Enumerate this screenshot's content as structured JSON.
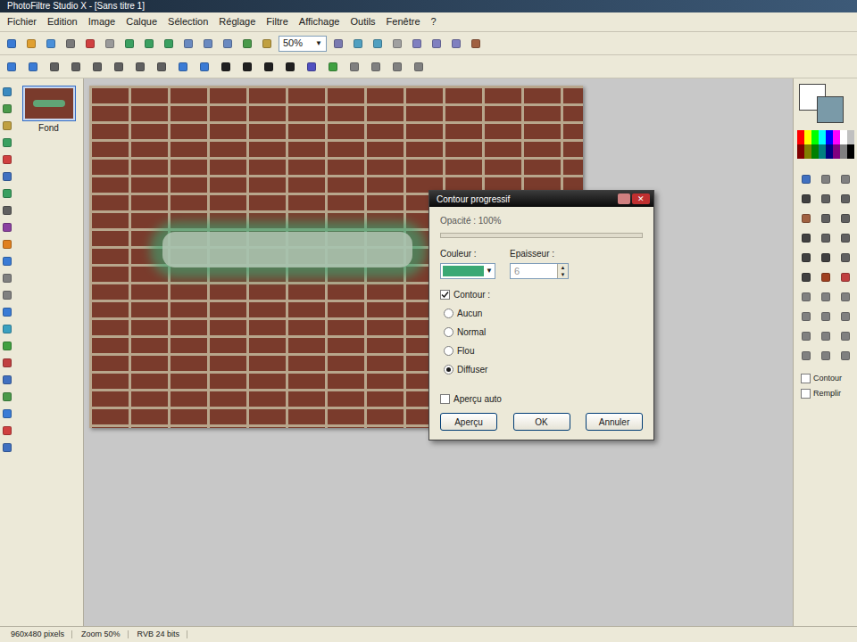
{
  "window": {
    "title": "PhotoFiltre Studio X - [Sans titre 1]"
  },
  "menu": [
    "Fichier",
    "Edition",
    "Image",
    "Calque",
    "Sélection",
    "Réglage",
    "Filtre",
    "Affichage",
    "Outils",
    "Fenêtre",
    "?"
  ],
  "toolbar": {
    "zoom": "50%"
  },
  "layers": [
    {
      "label": "Fond",
      "selected": true
    }
  ],
  "dialog": {
    "title": "Contour progressif",
    "opacity_label": "Opacité : 100%",
    "opacity_level": 1,
    "color_label": "Couleur :",
    "color": "#3aa874",
    "thickness_label": "Epaisseur :",
    "thickness": "6",
    "contour_checkbox": {
      "label": "Contour :",
      "checked": true
    },
    "options": [
      {
        "label": "Aucun",
        "selected": false
      },
      {
        "label": "Normal",
        "selected": false
      },
      {
        "label": "Flou",
        "selected": false
      },
      {
        "label": "Diffuser",
        "selected": true
      }
    ],
    "preview_checkbox": {
      "label": "Aperçu auto",
      "checked": false
    },
    "buttons": [
      "Aperçu",
      "OK",
      "Annuler"
    ]
  },
  "colors": {
    "foreground": "#ffffff",
    "background": "#7a9aa8"
  },
  "palette": [
    {
      "color": "#ff0000"
    },
    {
      "color": "#ffff00"
    },
    {
      "color": "#00ff00"
    },
    {
      "color": "#00ffff"
    },
    {
      "color": "#0000ff"
    },
    {
      "color": "#ff00ff"
    },
    {
      "color": "#ffffff"
    },
    {
      "color": "#c0c0c0"
    },
    {
      "color": "#800000"
    },
    {
      "color": "#808000"
    },
    {
      "color": "#008000"
    },
    {
      "color": "#008080"
    },
    {
      "color": "#000080"
    },
    {
      "color": "#800080"
    },
    {
      "color": "#808080"
    },
    {
      "color": "#000000"
    }
  ],
  "right_panel": {
    "options": [
      {
        "label": "Contour",
        "checked": false
      },
      {
        "label": "Remplir",
        "checked": false
      }
    ]
  },
  "status_bar": [
    "960x480 pixels",
    "Zoom 50%",
    "RVB 24 bits"
  ]
}
